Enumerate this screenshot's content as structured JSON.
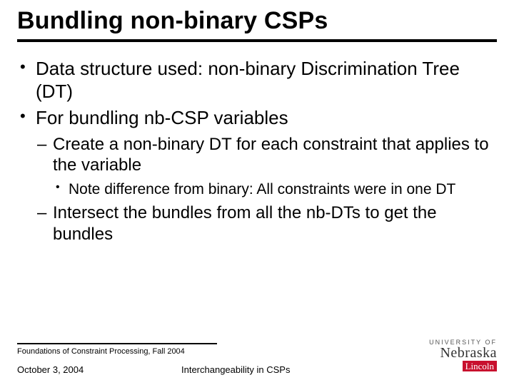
{
  "title": "Bundling non-binary CSPs",
  "bullets": {
    "b1": "Data structure used: non-binary Discrimination Tree (DT)",
    "b2": "For bundling nb-CSP variables",
    "b2_1": "Create a non-binary DT for each constraint that applies to the variable",
    "b2_1_1": "Note difference from binary: All constraints were in one DT",
    "b2_2": "Intersect the bundles from all the nb-DTs to get the bundles"
  },
  "footer": {
    "course": "Foundations of Constraint Processing, Fall 2004",
    "date": "October 3, 2004",
    "center": "Interchangeability in CSPs"
  },
  "logo": {
    "top": "UNIVERSITY OF",
    "main": "Nebraska",
    "sub": "Lincoln"
  }
}
